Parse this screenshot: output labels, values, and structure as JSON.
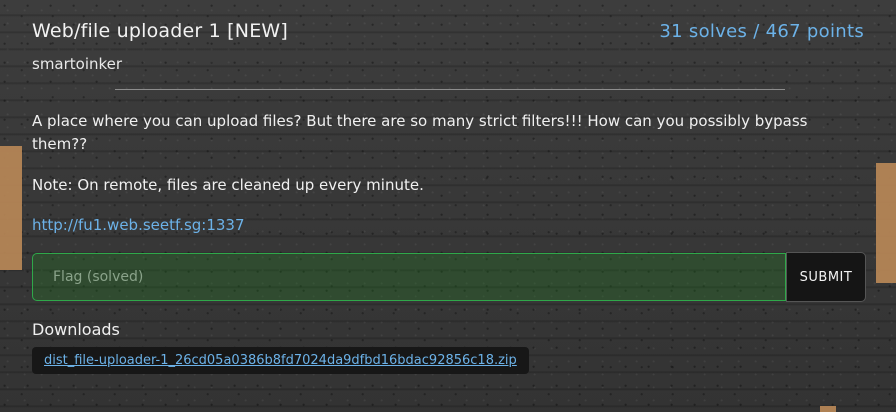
{
  "challenge": {
    "title": "Web/file uploader 1 [NEW]",
    "solves_points": "31 solves / 467 points",
    "author": "smartoinker",
    "description": "A place where you can upload files? But there are so many strict filters!!! How can you possibly bypass them??",
    "note": "Note: On remote, files are cleaned up every minute.",
    "link": "http://fu1.web.seetf.sg:1337"
  },
  "flag_form": {
    "placeholder": "Flag (solved)",
    "value": "",
    "submit_label": "SUBMIT"
  },
  "downloads": {
    "label": "Downloads",
    "files": [
      "dist_file-uploader-1_26cd05a0386b8fd7024da9dfbd16bdac92856c18.zip"
    ]
  },
  "colors": {
    "accent": "#6cb2e8",
    "flag_border": "#2fa84a",
    "submit_bg": "#151515",
    "tape": "#b88857"
  }
}
